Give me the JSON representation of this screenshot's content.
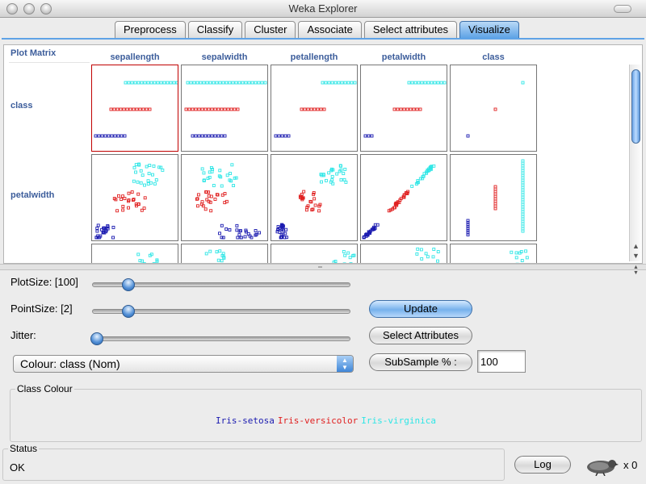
{
  "window": {
    "title": "Weka Explorer"
  },
  "tabs": [
    "Preprocess",
    "Classify",
    "Cluster",
    "Associate",
    "Select attributes",
    "Visualize"
  ],
  "active_tab": "Visualize",
  "matrix": {
    "title": "Plot Matrix",
    "columns": [
      "sepallength",
      "sepalwidth",
      "petallength",
      "petalwidth",
      "class"
    ],
    "rows": [
      "class",
      "petalwidth"
    ]
  },
  "controls": {
    "plotsize_label": "PlotSize: [100]",
    "pointsize_label": "PointSize: [2]",
    "jitter_label": "Jitter:",
    "plotsize_value": 0.13,
    "pointsize_value": 0.13,
    "jitter_value": 0.0,
    "update_button": "Update",
    "select_attributes_button": "Select Attributes",
    "colour_select": "Colour: class  (Nom)",
    "subsample_button": "SubSample % :",
    "subsample_value": "100"
  },
  "class_colour": {
    "title": "Class Colour",
    "entries": [
      {
        "name": "Iris-setosa",
        "color": "#1a1ab0"
      },
      {
        "name": "Iris-versicolor",
        "color": "#e02020"
      },
      {
        "name": "Iris-virginica",
        "color": "#2ee6e6"
      }
    ]
  },
  "status": {
    "title": "Status",
    "text": "OK"
  },
  "log_button": "Log",
  "task_count": "x 0"
}
